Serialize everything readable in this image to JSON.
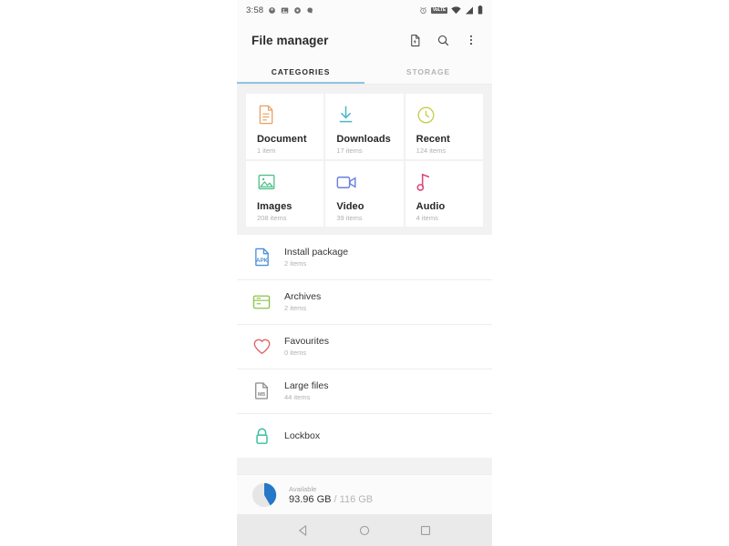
{
  "statusbar": {
    "time": "3:58",
    "left_icons": [
      "location-icon",
      "photo-icon",
      "settings-icon",
      "search-app-icon"
    ],
    "right_icons": [
      "alarm-icon",
      "volte-icon",
      "wifi-icon",
      "signal-icon",
      "battery-icon"
    ],
    "volte_label": "VoLTE"
  },
  "appbar": {
    "title": "File manager",
    "actions": [
      {
        "name": "new-file-icon"
      },
      {
        "name": "search-icon"
      },
      {
        "name": "overflow-menu-icon"
      }
    ]
  },
  "tabs": [
    {
      "label": "CATEGORIES",
      "active": true
    },
    {
      "label": "STORAGE",
      "active": false
    }
  ],
  "categories": [
    {
      "title": "Document",
      "count": "1 item",
      "icon": "document-icon",
      "color": "#e8a060"
    },
    {
      "title": "Downloads",
      "count": "17 items",
      "icon": "download-icon",
      "color": "#4fb6c6"
    },
    {
      "title": "Recent",
      "count": "124 items",
      "icon": "clock-icon",
      "color": "#c6cc46"
    },
    {
      "title": "Images",
      "count": "208 items",
      "icon": "image-icon",
      "color": "#4fc08a"
    },
    {
      "title": "Video",
      "count": "39 items",
      "icon": "video-icon",
      "color": "#6a7fe0"
    },
    {
      "title": "Audio",
      "count": "4 items",
      "icon": "audio-icon",
      "color": "#e0467a"
    }
  ],
  "list": [
    {
      "title": "Install package",
      "count": "2 items",
      "icon": "apk-icon",
      "color": "#4a90d9",
      "badge": "APK"
    },
    {
      "title": "Archives",
      "count": "2 items",
      "icon": "archive-icon",
      "color": "#8bc34a"
    },
    {
      "title": "Favourites",
      "count": "0 items",
      "icon": "heart-icon",
      "color": "#e06464"
    },
    {
      "title": "Large files",
      "count": "44 items",
      "icon": "large-file-icon",
      "color": "#8a8a8a",
      "badge": "MB"
    },
    {
      "title": "Lockbox",
      "count": "",
      "icon": "lock-icon",
      "color": "#35bfa0"
    }
  ],
  "storage": {
    "label": "Available",
    "available": "93.96 GB",
    "separator": " / ",
    "total": "116 GB",
    "accent": "#2577c8"
  },
  "navbar": [
    {
      "name": "nav-back-icon"
    },
    {
      "name": "nav-home-icon"
    },
    {
      "name": "nav-recents-icon"
    }
  ]
}
